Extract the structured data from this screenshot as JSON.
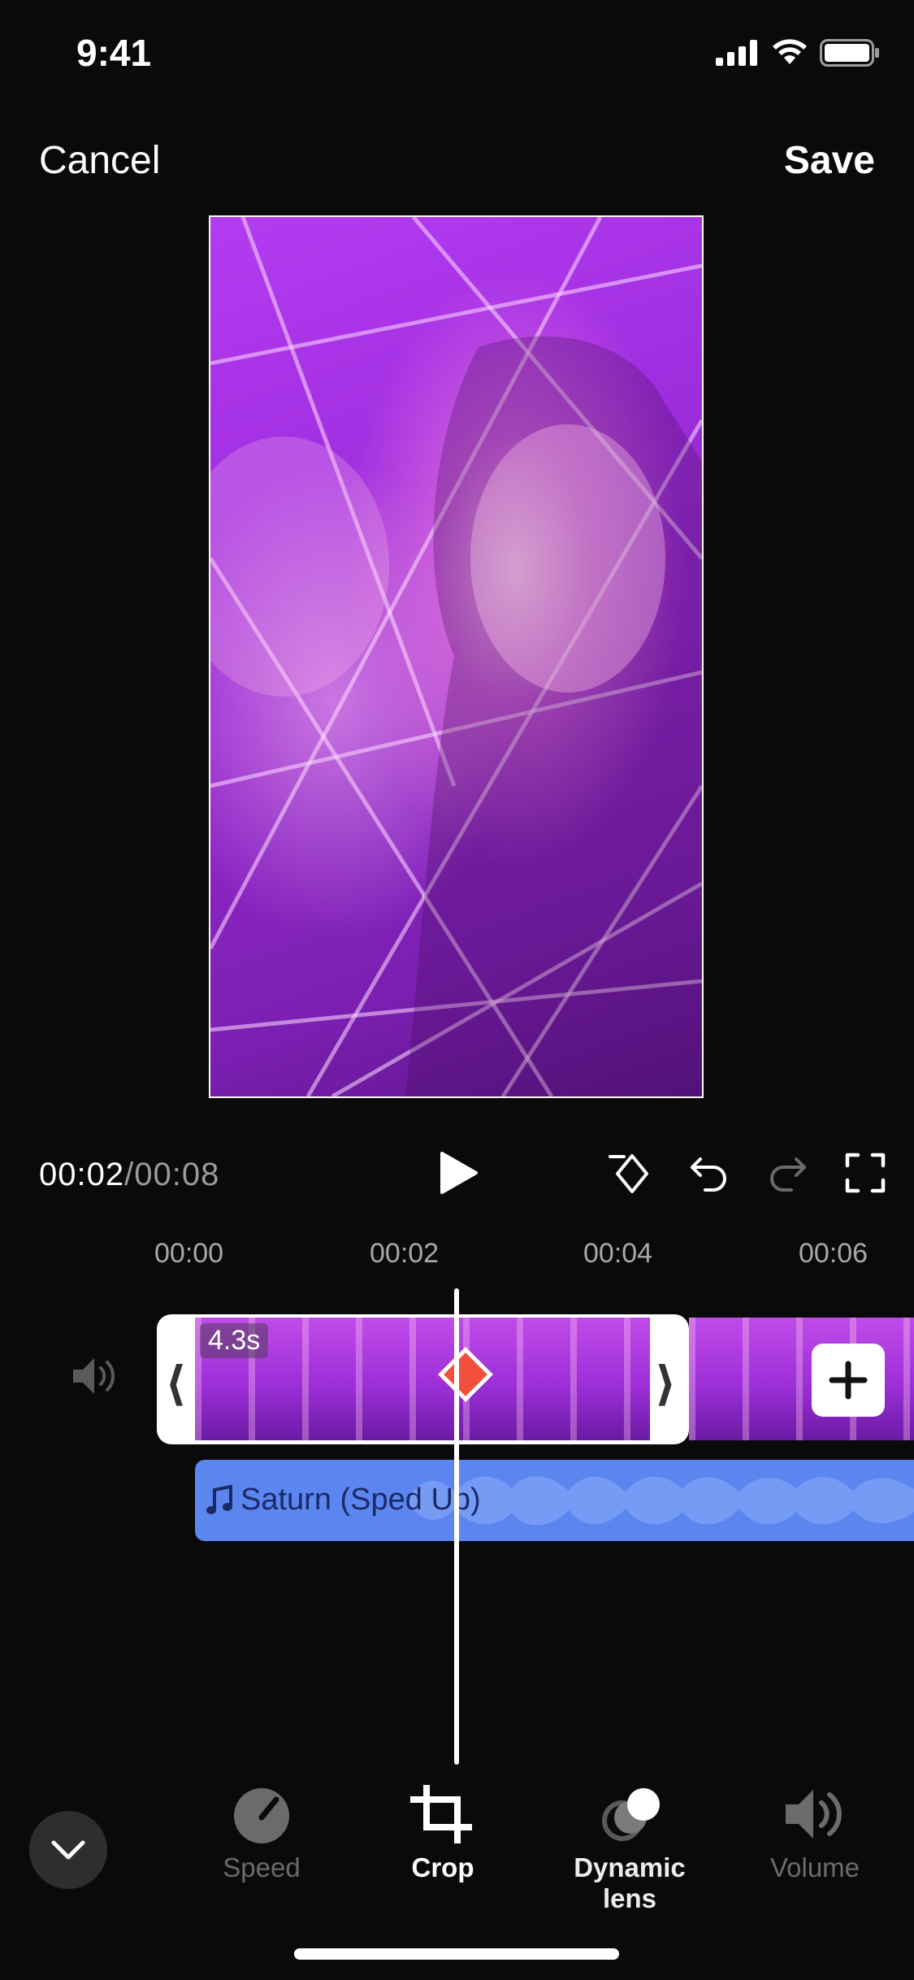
{
  "status_bar": {
    "time": "9:41"
  },
  "header": {
    "cancel_label": "Cancel",
    "save_label": "Save"
  },
  "playback": {
    "current_time": "00:02",
    "separator": "/",
    "total_time": "00:08"
  },
  "ruler": {
    "ticks": [
      "00:00",
      "00:02",
      "00:04",
      "00:06"
    ]
  },
  "clip": {
    "duration_badge": "4.3s",
    "left_handle": "⟨",
    "right_handle": "⟩"
  },
  "audio": {
    "title": "Saturn (Sped Up)"
  },
  "toolbar": {
    "items": [
      {
        "label": "Speed",
        "icon": "speedometer-icon",
        "state": "disabled"
      },
      {
        "label": "Crop",
        "icon": "crop-icon",
        "state": "active"
      },
      {
        "label": "Dynamic lens",
        "icon": "dynamic-lens-icon",
        "state": "enabled"
      },
      {
        "label": "Volume",
        "icon": "volume-icon",
        "state": "disabled"
      }
    ]
  },
  "colors": {
    "background": "#0a0a0b",
    "keyframe": "#f2503c",
    "audio_track": "#5c86ef",
    "dim_text": "#6b6b6b"
  }
}
